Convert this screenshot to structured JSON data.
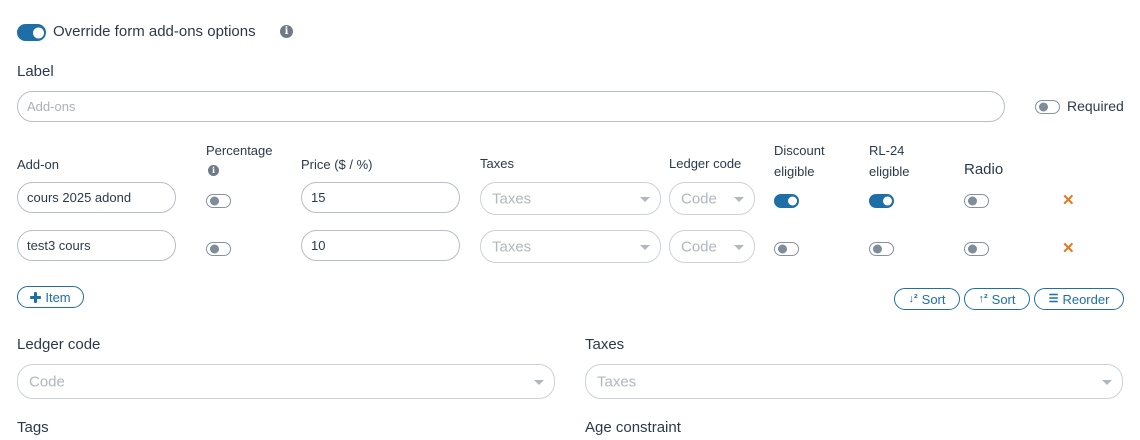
{
  "override": {
    "label": "Override form add-ons options",
    "enabled": true
  },
  "label_field": {
    "label": "Label",
    "placeholder": "Add-ons"
  },
  "required": {
    "label": "Required",
    "enabled": false
  },
  "columns": {
    "addon": "Add-on",
    "percentage": "Percentage",
    "price": "Price ($ / %)",
    "taxes": "Taxes",
    "ledger_code": "Ledger code",
    "discount": [
      "Discount",
      "eligible"
    ],
    "rl24": [
      "RL-24",
      "eligible"
    ],
    "radio": "Radio"
  },
  "rows": [
    {
      "name": "cours 2025 adond",
      "percentage": false,
      "price": "15",
      "taxes_placeholder": "Taxes",
      "code_placeholder": "Code",
      "discount": true,
      "rl24": true,
      "radio": false
    },
    {
      "name": "test3 cours",
      "percentage": false,
      "price": "10",
      "taxes_placeholder": "Taxes",
      "code_placeholder": "Code",
      "discount": false,
      "rl24": false,
      "radio": false
    }
  ],
  "buttons": {
    "add_item": "Item",
    "sort_asc": "Sort",
    "sort_desc": "Sort",
    "reorder": "Reorder"
  },
  "ledger": {
    "label": "Ledger code",
    "placeholder": "Code"
  },
  "taxes": {
    "label": "Taxes",
    "placeholder": "Taxes"
  },
  "tags": {
    "label": "Tags"
  },
  "age": {
    "label": "Age constraint"
  },
  "colors": {
    "accent": "#1e6fa7",
    "remove": "#e07a1f",
    "text": "#2b3a4a",
    "placeholder": "#a9b1ba"
  },
  "icons": {
    "info": "info-icon",
    "remove": "close-icon",
    "add": "plus-icon",
    "sort_asc": "sort-ascending-icon",
    "sort_desc": "sort-descending-icon",
    "reorder": "list-icon"
  }
}
